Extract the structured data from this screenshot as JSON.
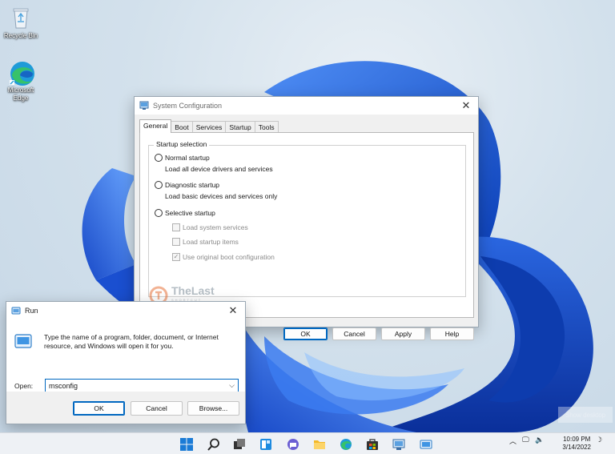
{
  "desktop": {
    "icons": [
      {
        "label": "Recycle Bin",
        "icon": "recycle-bin-icon"
      },
      {
        "label": "Microsoft Edge",
        "icon": "edge-icon"
      }
    ],
    "show_desktop_label": "Show desktop"
  },
  "watermark": {
    "brand_primary": "TheLast",
    "brand_secondary": "SHORTCUT"
  },
  "msconfig": {
    "title": "System Configuration",
    "tabs": [
      "General",
      "Boot",
      "Services",
      "Startup",
      "Tools"
    ],
    "active_tab": "General",
    "group_label": "Startup selection",
    "options": [
      {
        "label": "Normal startup",
        "description": "Load all device drivers and services"
      },
      {
        "label": "Diagnostic startup",
        "description": "Load basic devices and services only"
      },
      {
        "label": "Selective startup",
        "description": ""
      }
    ],
    "checkboxes": [
      {
        "label": "Load system services",
        "checked": false
      },
      {
        "label": "Load startup items",
        "checked": false
      },
      {
        "label": "Use original boot configuration",
        "checked": true
      }
    ],
    "buttons": {
      "ok": "OK",
      "cancel": "Cancel",
      "apply": "Apply",
      "help": "Help"
    }
  },
  "run": {
    "title": "Run",
    "message": "Type the name of a program, folder, document, or Internet resource, and Windows will open it for you.",
    "open_label": "Open:",
    "open_value": "msconfig",
    "buttons": {
      "ok": "OK",
      "cancel": "Cancel",
      "browse": "Browse..."
    }
  },
  "taskbar": {
    "apps": [
      "start-icon",
      "search-icon",
      "task-view-icon",
      "widgets-icon",
      "chat-icon",
      "file-explorer-icon",
      "edge-icon",
      "store-icon",
      "msconfig-icon",
      "run-icon"
    ],
    "time": "10:09 PM",
    "date": "3/14/2022"
  },
  "colors": {
    "accent": "#0067c0",
    "bloom": "#1f5fd6"
  }
}
